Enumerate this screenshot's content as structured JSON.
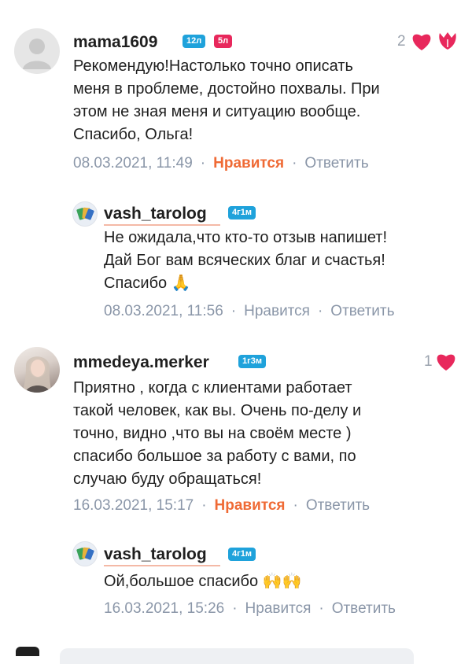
{
  "comments": [
    {
      "username": "mama1609",
      "badges": [
        "12л",
        "5л"
      ],
      "likes_count": "2",
      "text": "Рекомендую!Настолько точно описать\nменя в  проблеме, достойно похвалы. При\nэтом не зная меня и ситуацию вообще.\nСпасибо, Ольга!",
      "date": "08.03.2021, 11:49",
      "like_label": "Нравится",
      "reply_label": "Ответить",
      "reply": {
        "username": "vash_tarolog",
        "badge": "4г1м",
        "text": "Не ожидала,что кто-то отзыв напишет!\nДай Бог вам всяческих благ и счастья!\nСпасибо 🙏",
        "date": "08.03.2021, 11:56",
        "like_label": "Нравится",
        "reply_label": "Ответить"
      }
    },
    {
      "username": "mmedeya.merker",
      "badges": [
        "1г3м"
      ],
      "likes_count": "1",
      "text": "Приятно , когда с клиентами работает\nтакой человек, как вы. Очень по-делу и\nточно, видно ,что вы на своём месте )\nспасибо большое за работу с вами, по\nслучаю буду обращаться!",
      "date": "16.03.2021, 15:17",
      "like_label": "Нравится",
      "reply_label": "Ответить",
      "reply": {
        "username": "vash_tarolog",
        "badge": "4г1м",
        "text": "Ой,большое спасибо 🙌🙌",
        "date": "16.03.2021, 15:26",
        "like_label": "Нравится",
        "reply_label": "Ответить"
      }
    }
  ],
  "colors": {
    "like_active": "#ef6a35",
    "heart": "#e8285c",
    "badge_blue": "#1fa2db",
    "badge_pink": "#e8285c",
    "meta_gray": "#8a96a8"
  }
}
